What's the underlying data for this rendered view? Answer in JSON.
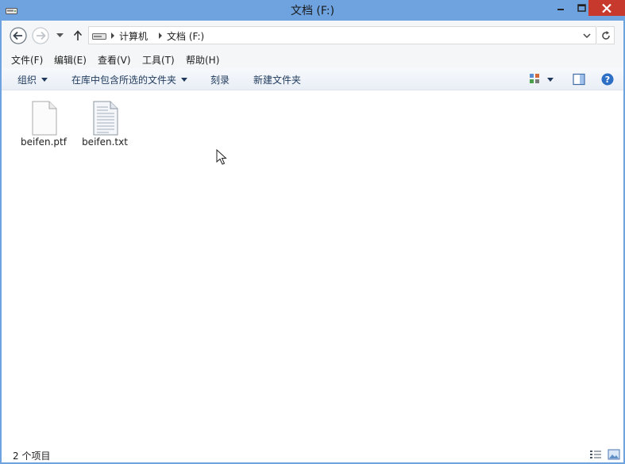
{
  "window": {
    "title": "文档 (F:)",
    "accent_color": "#6ea3df",
    "close_color": "#c7392d"
  },
  "nav": {
    "back_icon": "back-arrow-icon",
    "forward_icon": "forward-arrow-icon",
    "up_icon": "up-arrow-icon",
    "breadcrumbs": [
      "计算机",
      "文档 (F:)"
    ],
    "refresh_icon": "refresh-icon"
  },
  "menu": {
    "items": [
      "文件(F)",
      "编辑(E)",
      "查看(V)",
      "工具(T)",
      "帮助(H)"
    ]
  },
  "commands": {
    "organize": "组织",
    "include_in_library": "在库中包含所选的文件夹",
    "burn": "刻录",
    "new_folder": "新建文件夹"
  },
  "files": [
    {
      "name": "beifen.ptf",
      "icon": "blank-file-icon"
    },
    {
      "name": "beifen.txt",
      "icon": "text-file-icon"
    }
  ],
  "status": {
    "item_count": "2 个项目"
  }
}
